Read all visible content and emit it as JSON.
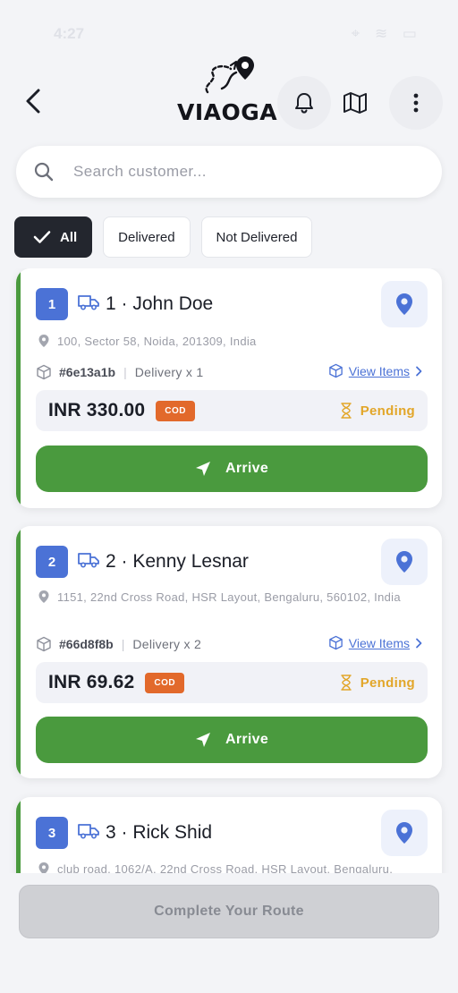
{
  "status_bar": {
    "time": "4:27",
    "icons": "⌖ ≋ ▭"
  },
  "header": {
    "brand": "VIAOGA",
    "icons": [
      "back-arrow",
      "bell",
      "map",
      "more-vertical"
    ]
  },
  "search": {
    "placeholder": "Search customer..."
  },
  "filters": [
    {
      "label": "All",
      "active": true
    },
    {
      "label": "Delivered",
      "active": false
    },
    {
      "label": "Not Delivered",
      "active": false
    }
  ],
  "deliveries": [
    {
      "number": "1",
      "name": "1 · John Doe",
      "address": "100, Sector 58, Noida, 201309, India",
      "order_id": "#6e13a1b",
      "qty": "Delivery x 1",
      "view_items": "View Items",
      "amount": "INR 330.00",
      "payment": "COD",
      "status": "Pending",
      "action": "Arrive"
    },
    {
      "number": "2",
      "name": "2 · Kenny Lesnar",
      "address": "1151, 22nd Cross Road, HSR Layout, Bengaluru, 560102, India",
      "order_id": "#66d8f8b",
      "qty": "Delivery x 2",
      "view_items": "View Items",
      "amount": "INR 69.62",
      "payment": "COD",
      "status": "Pending",
      "action": "Arrive"
    },
    {
      "number": "3",
      "name": "3 · Rick Shid",
      "address": "club road, 1062/A, 22nd Cross Road, HSR Layout, Bengaluru,"
    }
  ],
  "footer": {
    "complete_label": "Complete Your Route"
  },
  "colors": {
    "accent_blue": "#4b72d6",
    "green": "#4a9a3e",
    "pending": "#e2a629",
    "cod": "#e2692b",
    "dark_chip": "#23262e"
  }
}
